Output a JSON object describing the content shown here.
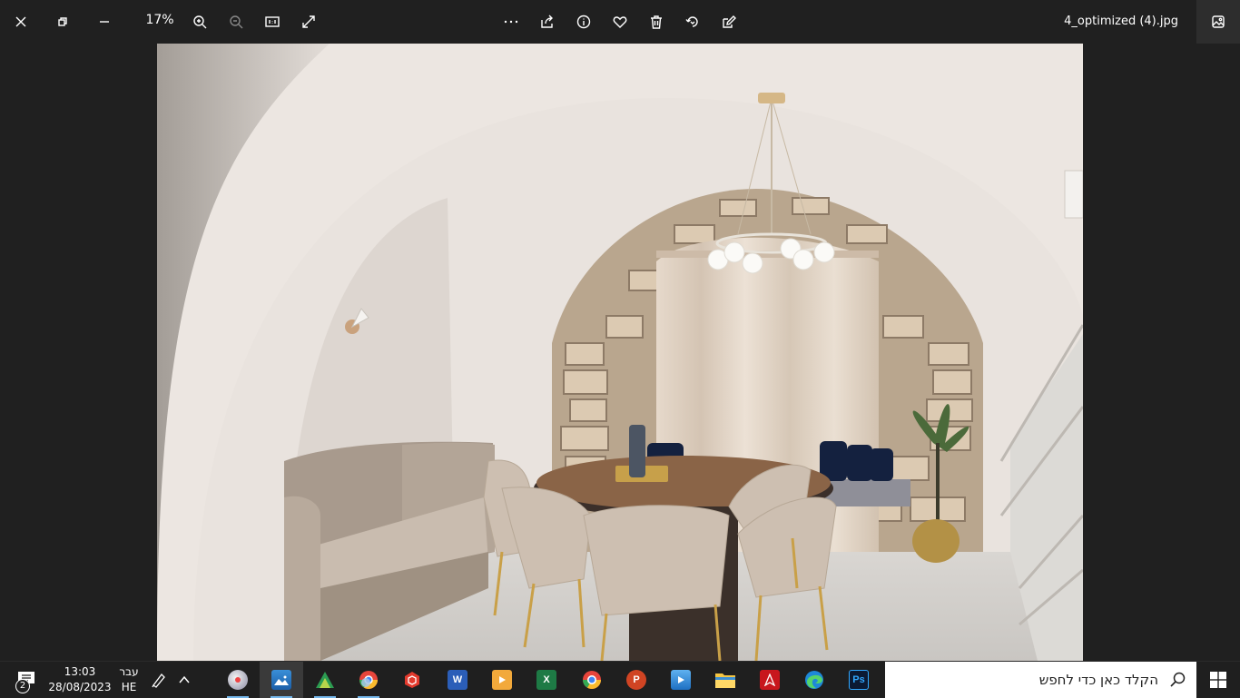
{
  "titlebar": {
    "zoom": "17%",
    "filename": "4_optimized (4).jpg",
    "icons": [
      "close-icon",
      "restore-icon",
      "minimize-icon",
      "zoom-in-icon",
      "zoom-out-icon",
      "actual-size-icon",
      "fullscreen-icon",
      "more-icon",
      "share-icon",
      "info-icon",
      "favorite-icon",
      "delete-icon",
      "rotate-icon",
      "edit-icon",
      "image-panel-icon"
    ]
  },
  "taskbar": {
    "time": "13:03",
    "date": "28/08/2023",
    "lang_name": "עבר",
    "lang_code": "HE",
    "notification_count": "2",
    "search_placeholder": "הקלד כאן כדי לחפש",
    "apps": [
      {
        "name": "paint-app",
        "label": ""
      },
      {
        "name": "photos-app",
        "label": ""
      },
      {
        "name": "autodesk-app",
        "label": ""
      },
      {
        "name": "chrome-profiles-app",
        "label": ""
      },
      {
        "name": "sketchup-app",
        "label": ""
      },
      {
        "name": "word-app",
        "label": "W"
      },
      {
        "name": "video-app",
        "label": ""
      },
      {
        "name": "excel-app",
        "label": "X"
      },
      {
        "name": "chrome-app",
        "label": ""
      },
      {
        "name": "powerpoint-app",
        "label": "P"
      },
      {
        "name": "media-app",
        "label": ""
      },
      {
        "name": "file-explorer-app",
        "label": ""
      },
      {
        "name": "acrobat-app",
        "label": ""
      },
      {
        "name": "edge-app",
        "label": ""
      },
      {
        "name": "photoshop-app",
        "label": "Ps"
      }
    ]
  },
  "colors": {
    "titlebar_bg": "#202020",
    "taskbar_bg": "#1f1f1f",
    "accent": "#76b9ed"
  }
}
